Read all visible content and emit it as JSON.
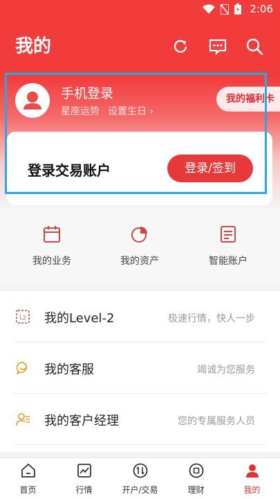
{
  "status_bar": {
    "time": "2:06"
  },
  "header": {
    "title": "我的"
  },
  "profile": {
    "login_title": "手机登录",
    "horoscope_link": "星座运势",
    "birthday_link": "设置生日 ›"
  },
  "welfare_tab": {
    "label": "我的福利卡"
  },
  "trade_card": {
    "label": "登录交易账户",
    "button": "登录/签到"
  },
  "quick_actions": [
    {
      "label": "我的业务",
      "icon": "calendar-icon"
    },
    {
      "label": "我的资产",
      "icon": "pie-chart-icon"
    },
    {
      "label": "智能账户",
      "icon": "document-icon"
    }
  ],
  "menu": [
    {
      "label": "我的Level-2",
      "desc": "极速行情，快人一步",
      "icon": "level2-icon"
    },
    {
      "label": "我的客服",
      "desc": "竭诚为您服务",
      "icon": "chat-bubble-icon"
    },
    {
      "label": "我的客户经理",
      "desc": "您的专属服务人员",
      "icon": "manager-icon"
    }
  ],
  "bottom_nav": [
    {
      "label": "首页",
      "icon": "home-icon"
    },
    {
      "label": "行情",
      "icon": "chart-icon"
    },
    {
      "label": "开户/交易",
      "icon": "trade-icon"
    },
    {
      "label": "理财",
      "icon": "finance-icon"
    },
    {
      "label": "我的",
      "icon": "person-icon",
      "active": true
    }
  ],
  "colors": {
    "brand_red": "#e8393a",
    "highlight_blue": "#2aa8e6"
  }
}
